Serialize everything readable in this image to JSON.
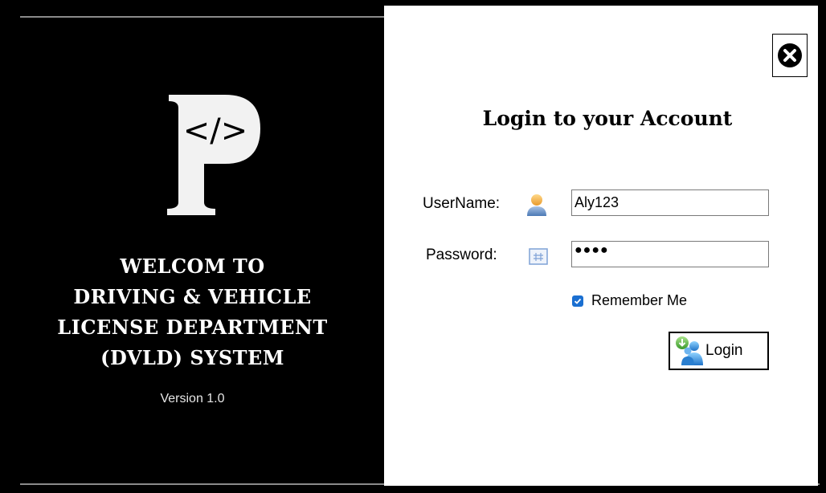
{
  "left_panel": {
    "logo_letter": "P",
    "logo_glyph": "</>",
    "welcome_lines": [
      "WELCOM TO",
      "DRIVING & VEHICLE",
      "LICENSE DEPARTMENT",
      "(DVLD) SYSTEM"
    ],
    "version": "Version 1.0"
  },
  "login_form": {
    "title": "Login to your Account",
    "username_label": "UserName:",
    "username_value": "Aly123",
    "username_icon": "user-icon",
    "password_label": "Password:",
    "password_value": "●●●●",
    "password_icon": "password-icon",
    "remember_label": "Remember Me",
    "remember_checked": true,
    "login_button_label": "Login",
    "login_button_icon": "login-users-icon",
    "close_icon": "close-icon"
  },
  "colors": {
    "left_background": "#000000",
    "right_background": "#ffffff",
    "checkbox_accent": "#1a6fd1"
  }
}
